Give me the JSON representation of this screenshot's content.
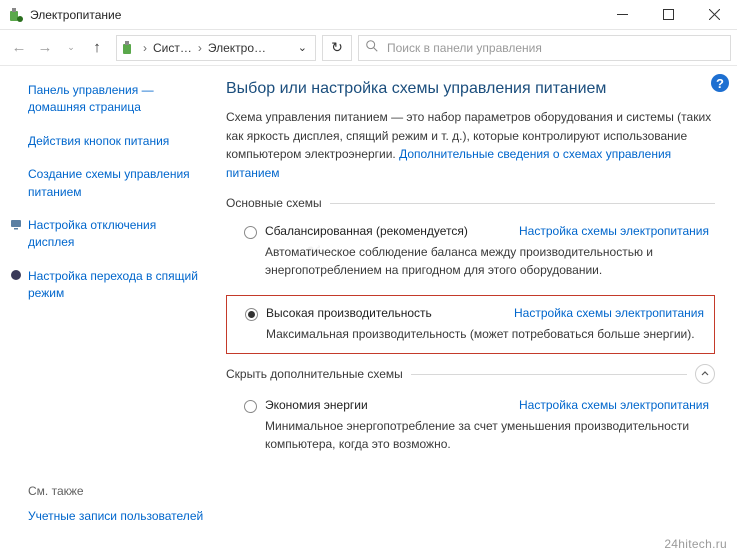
{
  "window": {
    "title": "Электропитание"
  },
  "nav": {
    "breadcrumb": {
      "part1": "Сист…",
      "part2": "Электро…"
    },
    "search_placeholder": "Поиск в панели управления"
  },
  "sidebar": {
    "items": [
      {
        "label": "Панель управления — домашняя страница"
      },
      {
        "label": "Действия кнопок питания"
      },
      {
        "label": "Создание схемы управления питанием"
      },
      {
        "label": "Настройка отключения дисплея",
        "icon": "monitor"
      },
      {
        "label": "Настройка перехода в спящий режим",
        "icon": "moon"
      }
    ],
    "see_also_heading": "См. также",
    "see_also_link": "Учетные записи пользователей"
  },
  "main": {
    "heading": "Выбор или настройка схемы управления питанием",
    "desc_text": "Схема управления питанием — это набор параметров оборудования и системы (таких как яркость дисплея, спящий режим и т. д.), которые контролируют использование компьютером электроэнергии. ",
    "desc_link": "Дополнительные сведения о схемах управления питанием",
    "group1": "Основные схемы",
    "group2": "Скрыть дополнительные схемы",
    "plans": [
      {
        "name": "Сбалансированная (рекомендуется)",
        "link": "Настройка схемы электропитания",
        "desc": "Автоматическое соблюдение баланса между производительностью и энергопотреблением на пригодном для этого оборудовании.",
        "checked": false
      },
      {
        "name": "Высокая производительность",
        "link": "Настройка схемы электропитания",
        "desc": "Максимальная производительность (может потребоваться больше энергии).",
        "checked": true,
        "highlighted": true
      },
      {
        "name": "Экономия энергии",
        "link": "Настройка схемы электропитания",
        "desc": "Минимальное энергопотребление за счет уменьшения производительности компьютера, когда это возможно.",
        "checked": false
      }
    ],
    "help_badge": "?"
  },
  "watermark": "24hitech.ru"
}
